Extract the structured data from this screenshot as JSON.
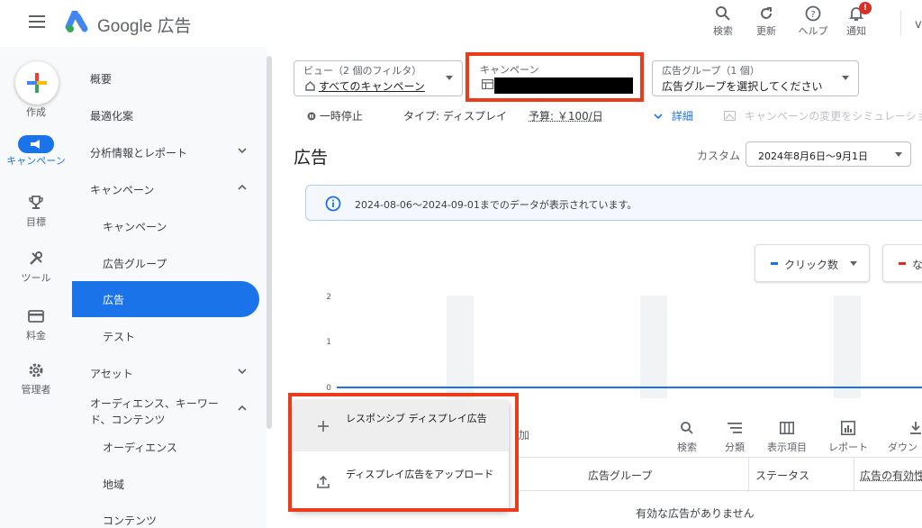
{
  "app": {
    "brand": "Google 広告"
  },
  "top_actions": [
    {
      "label": "検索",
      "icon": "search-icon"
    },
    {
      "label": "更新",
      "icon": "refresh-icon"
    },
    {
      "label": "ヘルプ",
      "icon": "help-icon"
    },
    {
      "label": "通知",
      "icon": "bell-icon",
      "badge": "!"
    }
  ],
  "rail": {
    "create": "作成",
    "items": [
      {
        "label": "キャンペーン",
        "icon": "campaign-icon",
        "active": true
      },
      {
        "label": "目標",
        "icon": "trophy-icon"
      },
      {
        "label": "ツール",
        "icon": "tools-icon"
      },
      {
        "label": "料金",
        "icon": "billing-icon"
      },
      {
        "label": "管理者",
        "icon": "gear-icon"
      }
    ]
  },
  "nav": {
    "items": [
      {
        "label": "概要"
      },
      {
        "label": "最適化案"
      },
      {
        "label": "分析情報とレポート",
        "chevron": "down"
      },
      {
        "label": "キャンペーン",
        "chevron": "up"
      },
      {
        "label": "キャンペーン",
        "sub": true
      },
      {
        "label": "広告グループ",
        "sub": true
      },
      {
        "label": "広告",
        "sub": true,
        "active": true
      },
      {
        "label": "テスト",
        "sub": true
      },
      {
        "label": "アセット",
        "chevron": "down"
      },
      {
        "label": "オーディエンス、キーワード、コンテンツ",
        "label_line1": "オーディエンス、キーワー",
        "label_line2": "ド、コンテンツ",
        "chevron": "up"
      },
      {
        "label": "オーディエンス",
        "sub": true
      },
      {
        "label": "地域",
        "sub": true
      },
      {
        "label": "コンテンツ",
        "sub": true
      }
    ]
  },
  "filters": {
    "view": {
      "caption": "ビュー（2 個のフィルタ）",
      "value": "すべてのキャンペーン"
    },
    "campaign": {
      "caption": "キャンペーン",
      "value": ""
    },
    "ad_group": {
      "caption": "広告グループ（1 個）",
      "value": "広告グループを選択してください"
    }
  },
  "campaign_info": {
    "status": "一時停止",
    "type": "タイプ: ディスプレイ",
    "budget": "予算: ￥100/日",
    "details": "詳細",
    "simulate": "キャンペーンの変更をシミュレーショ"
  },
  "page": {
    "title": "広告",
    "date_label": "カスタム",
    "date_range": "2024年8月6日〜9月1日"
  },
  "banner": {
    "text": "2024-08-06〜2024-09-01までのデータが表示されています。"
  },
  "metrics": [
    {
      "label": "クリック数",
      "color": "#1a73e8"
    },
    {
      "label": "な",
      "color": "#d93025"
    }
  ],
  "chart": {
    "y_ticks": [
      "2",
      "1",
      "0"
    ],
    "line_color": "#1a73e8"
  },
  "toolbar": {
    "add_text": "加",
    "items": [
      {
        "label": "検索",
        "icon": "search-icon"
      },
      {
        "label": "分類",
        "icon": "segment-icon"
      },
      {
        "label": "表示項目",
        "icon": "columns-icon"
      },
      {
        "label": "レポート",
        "icon": "report-icon"
      },
      {
        "label": "ダウン",
        "icon": "download-icon"
      }
    ]
  },
  "table": {
    "columns": [
      "広告グループ",
      "ステータス",
      "広告の有効性"
    ],
    "empty": "有効な広告がありません"
  },
  "popup": {
    "items": [
      {
        "label": "レスポンシブ ディスプレイ広告",
        "icon": "plus-icon"
      },
      {
        "label": "ディスプレイ広告をアップロード",
        "icon": "upload-icon"
      }
    ]
  },
  "colors": {
    "primary": "#1a73e8",
    "highlight": "#ea3b1a"
  }
}
